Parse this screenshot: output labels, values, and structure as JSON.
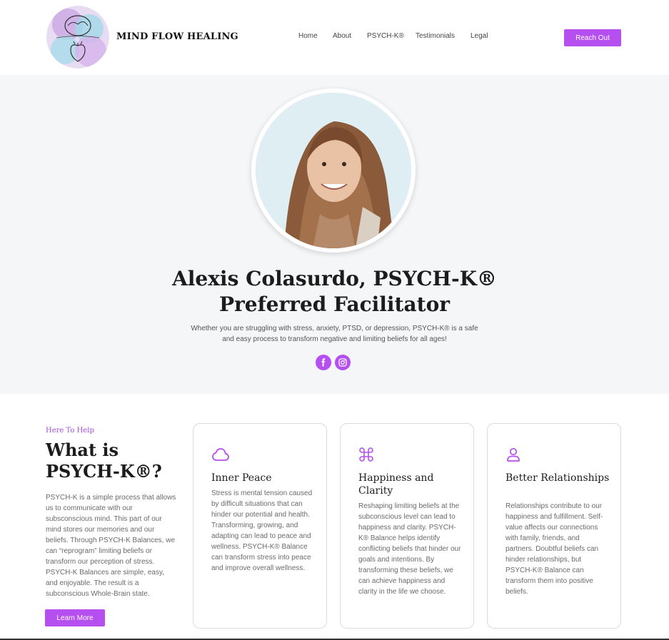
{
  "header": {
    "brand": "MIND FLOW HEALING",
    "nav": [
      "Home",
      "About",
      "PSYCH-K®",
      "Testimonials",
      "Legal"
    ],
    "cta_label": "Reach Out"
  },
  "hero": {
    "title_line1": "Alexis Colasurdo, PSYCH-K®",
    "title_line2": "Preferred Facilitator",
    "subtitle_line1": "Whether you are struggling with stress, anxiety, PTSD, or depression, PSYCH-K® is a safe",
    "subtitle_line2": "and easy process to transform negative and limiting beliefs for all ages!",
    "social": [
      "facebook-icon",
      "instagram-icon"
    ]
  },
  "intro": {
    "kicker": "Here To Help",
    "title_line1": "What is",
    "title_line2": "PSYCH-K®?",
    "text": "PSYCH-K is a simple process that allows us to communicate with our subsconscious mind. This part of our mind stores our memories and our beliefs. Through PSYCH-K Balances, we can “reprogram” limiting beliefs or transform our perception of stress. PSYCH-K Balances are simple, easy, and enjoyable. The result is a subconscious Whole-Brain state.",
    "button_label": "Learn More"
  },
  "cards": [
    {
      "icon": "cloud-icon",
      "title": "Inner Peace",
      "body": "Stress is mental tension caused by difficult situations that can hinder our potential and health. Transforming, growing, and adapting can lead to peace and wellness. PSYCH-K® Balance can transform stress into peace and improve overall wellness."
    },
    {
      "icon": "command-icon",
      "title": "Happiness and Clarity",
      "body": "Reshaping limiting beliefs at the subconscious level can lead to happiness and clarity. PSYCH-K® Balance helps identify conflicting beliefs that hinder our goals and intentions. By transforming these beliefs, we can achieve happiness and clarity in the life we choose."
    },
    {
      "icon": "user-icon",
      "title": "Better Relationships",
      "body": "Relationships contribute to our happiness and fulfillment. Self-value affects our connections with family, friends, and partners. Doubtful beliefs can hinder relationships, but PSYCH-K® Balance can transform them into positive beliefs."
    }
  ],
  "colors": {
    "accent": "#b64ff0",
    "hero_bg": "#f5f6f8"
  }
}
